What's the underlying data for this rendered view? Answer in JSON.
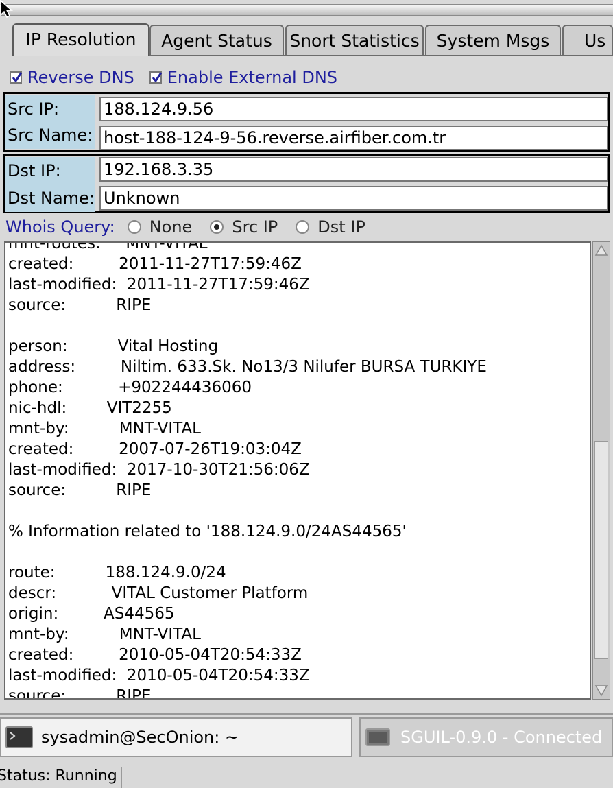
{
  "tabs": [
    "IP Resolution",
    "Agent Status",
    "Snort Statistics",
    "System Msgs",
    "Us"
  ],
  "options": {
    "reverse_dns": {
      "label": "Reverse DNS",
      "checked": true
    },
    "external_dns": {
      "label": "Enable External DNS",
      "checked": true
    }
  },
  "src": {
    "ip_label": "Src IP:",
    "ip_value": "188.124.9.56",
    "name_label": "Src Name:",
    "name_value": "host-188-124-9-56.reverse.airfiber.com.tr"
  },
  "dst": {
    "ip_label": "Dst IP:",
    "ip_value": "192.168.3.35",
    "name_label": "Dst Name:",
    "name_value": "Unknown"
  },
  "whois": {
    "label": "Whois Query:",
    "options": [
      "None",
      "Src IP",
      "Dst IP"
    ],
    "selected": "Src IP"
  },
  "whois_output": [
    "mnt-routes:     MNT-VITAL",
    "created:         2011-11-27T17:59:46Z",
    "last-modified:  2011-11-27T17:59:46Z",
    "source:          RIPE",
    "",
    "person:          Vital Hosting",
    "address:         Niltim. 633.Sk. No13/3 Nilufer BURSA TURKIYE",
    "phone:           +902244436060",
    "nic-hdl:        VIT2255",
    "mnt-by:          MNT-VITAL",
    "created:         2007-07-26T19:03:04Z",
    "last-modified:  2017-10-30T21:56:06Z",
    "source:          RIPE",
    "",
    "% Information related to '188.124.9.0/24AS44565'",
    "",
    "route:          188.124.9.0/24",
    "descr:           VITAL Customer Platform",
    "origin:         AS44565",
    "mnt-by:          MNT-VITAL",
    "created:         2010-05-04T20:54:33Z",
    "last-modified:  2010-05-04T20:54:33Z",
    "source:          RIPE"
  ],
  "taskbar": {
    "terminal": "sysadmin@SecOnion: ~",
    "sguil": "SGUIL-0.9.0 - Connected"
  },
  "status": "Status: Running",
  "colors": {
    "label_blue": "#1f1f9e",
    "ip_label_bg": "#bcd8e6"
  }
}
